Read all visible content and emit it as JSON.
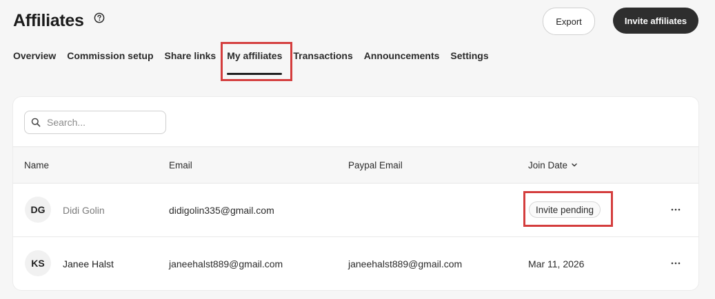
{
  "header": {
    "title": "Affiliates",
    "export_label": "Export",
    "invite_label": "Invite affiliates"
  },
  "tabs": [
    {
      "label": "Overview"
    },
    {
      "label": "Commission setup"
    },
    {
      "label": "Share links"
    },
    {
      "label": "My affiliates",
      "active": true
    },
    {
      "label": "Transactions"
    },
    {
      "label": "Announcements"
    },
    {
      "label": "Settings"
    }
  ],
  "search": {
    "placeholder": "Search...",
    "value": ""
  },
  "table": {
    "columns": [
      "Name",
      "Email",
      "Paypal Email",
      "Join Date"
    ],
    "rows": [
      {
        "initials": "DG",
        "name": "Didi Golin",
        "email": "didigolin335@gmail.com",
        "paypal_email": "",
        "join_date": "",
        "status": "Invite pending",
        "pending": true
      },
      {
        "initials": "KS",
        "name": "Janee Halst",
        "email": "janeehalst889@gmail.com",
        "paypal_email": "janeehalst889@gmail.com",
        "join_date": "Mar 11, 2026",
        "status": "",
        "pending": false
      }
    ]
  },
  "icons": {
    "help": "help-circle-icon",
    "search": "search-icon",
    "sort": "chevron-down-icon",
    "more": "more-horizontal-icon"
  },
  "colors": {
    "primary_button": "#2e2e2e",
    "highlight": "#d43d3d",
    "background": "#f6f6f6",
    "name_pending": "#7a7a7a"
  }
}
